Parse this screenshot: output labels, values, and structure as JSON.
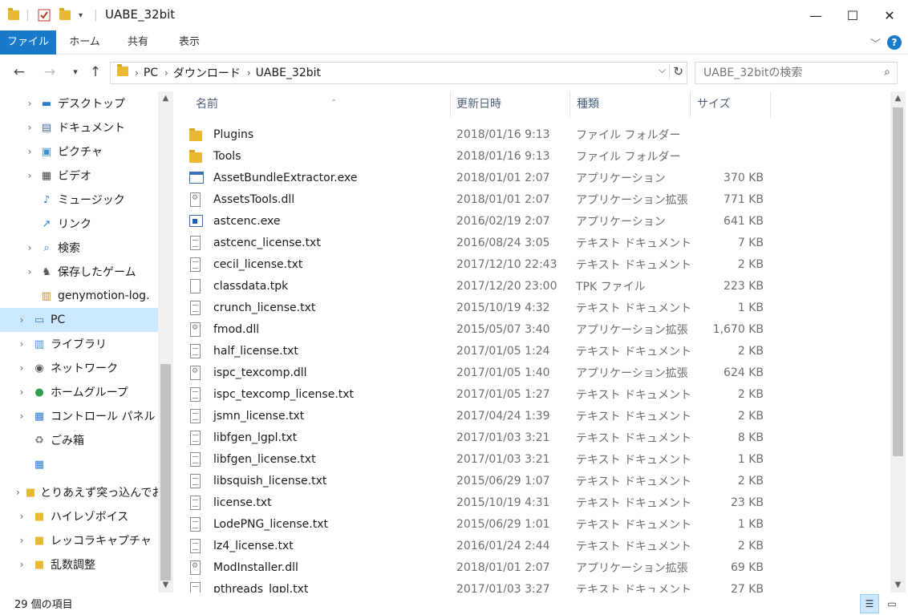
{
  "window": {
    "title": "UABE_32bit",
    "minimize": "—",
    "maximize": "☐",
    "close": "✕"
  },
  "ribbon": {
    "tabs": [
      "ファイル",
      "ホーム",
      "共有",
      "表示"
    ],
    "help": "?"
  },
  "address": {
    "crumbs": [
      "PC",
      "ダウンロード",
      "UABE_32bit"
    ]
  },
  "search": {
    "placeholder": "UABE_32bitの検索"
  },
  "nav_pane": {
    "items": [
      {
        "label": "デスクトップ",
        "icon": "desktop-icon",
        "expandable": true
      },
      {
        "label": "ドキュメント",
        "icon": "documents-icon",
        "expandable": true
      },
      {
        "label": "ピクチャ",
        "icon": "pictures-icon",
        "expandable": true
      },
      {
        "label": "ビデオ",
        "icon": "videos-icon",
        "expandable": true
      },
      {
        "label": "ミュージック",
        "icon": "music-icon",
        "expandable": false
      },
      {
        "label": "リンク",
        "icon": "links-icon",
        "expandable": false
      },
      {
        "label": "検索",
        "icon": "search-folder-icon",
        "expandable": true
      },
      {
        "label": "保存したゲーム",
        "icon": "saved-games-icon",
        "expandable": true
      },
      {
        "label": "genymotion-log.",
        "icon": "zip-icon",
        "expandable": false
      },
      {
        "label": "PC",
        "icon": "pc-icon",
        "expandable": true,
        "selected": true
      },
      {
        "label": "ライブラリ",
        "icon": "libraries-icon",
        "expandable": true
      },
      {
        "label": "ネットワーク",
        "icon": "network-icon",
        "expandable": true
      },
      {
        "label": "ホームグループ",
        "icon": "homegroup-icon",
        "expandable": true
      },
      {
        "label": "コントロール パネル",
        "icon": "control-panel-icon",
        "expandable": true
      },
      {
        "label": "ごみ箱",
        "icon": "recycle-bin-icon",
        "expandable": false
      },
      {
        "label": "",
        "icon": "control-panel-icon",
        "expandable": false
      },
      {
        "label": "とりあえず突っ込んでお",
        "icon": "folder-icon",
        "expandable": true
      },
      {
        "label": "ハイレゾボイス",
        "icon": "folder-icon",
        "expandable": true
      },
      {
        "label": "レッコラキャプチャ",
        "icon": "folder-icon",
        "expandable": true
      },
      {
        "label": "乱数調整",
        "icon": "folder-icon",
        "expandable": true
      }
    ]
  },
  "columns": {
    "name": "名前",
    "date": "更新日時",
    "type": "種類",
    "size": "サイズ"
  },
  "files": [
    {
      "name": "Plugins",
      "date": "2018/01/16 9:13",
      "type": "ファイル フォルダー",
      "size": "",
      "icon": "folder"
    },
    {
      "name": "Tools",
      "date": "2018/01/16 9:13",
      "type": "ファイル フォルダー",
      "size": "",
      "icon": "folder"
    },
    {
      "name": "AssetBundleExtractor.exe",
      "date": "2018/01/01 2:07",
      "type": "アプリケーション",
      "size": "370 KB",
      "icon": "exe"
    },
    {
      "name": "AssetsTools.dll",
      "date": "2018/01/01 2:07",
      "type": "アプリケーション拡張",
      "size": "771 KB",
      "icon": "dll"
    },
    {
      "name": "astcenc.exe",
      "date": "2016/02/19 2:07",
      "type": "アプリケーション",
      "size": "641 KB",
      "icon": "exe2"
    },
    {
      "name": "astcenc_license.txt",
      "date": "2016/08/24 3:05",
      "type": "テキスト ドキュメント",
      "size": "7 KB",
      "icon": "doc"
    },
    {
      "name": "cecil_license.txt",
      "date": "2017/12/10 22:43",
      "type": "テキスト ドキュメント",
      "size": "2 KB",
      "icon": "doc"
    },
    {
      "name": "classdata.tpk",
      "date": "2017/12/20 23:00",
      "type": "TPK ファイル",
      "size": "223 KB",
      "icon": "blank"
    },
    {
      "name": "crunch_license.txt",
      "date": "2015/10/19 4:32",
      "type": "テキスト ドキュメント",
      "size": "1 KB",
      "icon": "doc"
    },
    {
      "name": "fmod.dll",
      "date": "2015/05/07 3:40",
      "type": "アプリケーション拡張",
      "size": "1,670 KB",
      "icon": "dll"
    },
    {
      "name": "half_license.txt",
      "date": "2017/01/05 1:24",
      "type": "テキスト ドキュメント",
      "size": "2 KB",
      "icon": "doc"
    },
    {
      "name": "ispc_texcomp.dll",
      "date": "2017/01/05 1:40",
      "type": "アプリケーション拡張",
      "size": "624 KB",
      "icon": "dll"
    },
    {
      "name": "ispc_texcomp_license.txt",
      "date": "2017/01/05 1:27",
      "type": "テキスト ドキュメント",
      "size": "2 KB",
      "icon": "doc"
    },
    {
      "name": "jsmn_license.txt",
      "date": "2017/04/24 1:39",
      "type": "テキスト ドキュメント",
      "size": "2 KB",
      "icon": "doc"
    },
    {
      "name": "libfgen_lgpl.txt",
      "date": "2017/01/03 3:21",
      "type": "テキスト ドキュメント",
      "size": "8 KB",
      "icon": "doc"
    },
    {
      "name": "libfgen_license.txt",
      "date": "2017/01/03 3:21",
      "type": "テキスト ドキュメント",
      "size": "1 KB",
      "icon": "doc"
    },
    {
      "name": "libsquish_license.txt",
      "date": "2015/06/29 1:07",
      "type": "テキスト ドキュメント",
      "size": "2 KB",
      "icon": "doc"
    },
    {
      "name": "license.txt",
      "date": "2015/10/19 4:31",
      "type": "テキスト ドキュメント",
      "size": "23 KB",
      "icon": "doc"
    },
    {
      "name": "LodePNG_license.txt",
      "date": "2015/06/29 1:01",
      "type": "テキスト ドキュメント",
      "size": "1 KB",
      "icon": "doc"
    },
    {
      "name": "lz4_license.txt",
      "date": "2016/01/24 2:44",
      "type": "テキスト ドキュメント",
      "size": "2 KB",
      "icon": "doc"
    },
    {
      "name": "ModInstaller.dll",
      "date": "2018/01/01 2:07",
      "type": "アプリケーション拡張",
      "size": "69 KB",
      "icon": "dll"
    },
    {
      "name": "pthreads_lgpl.txt",
      "date": "2017/01/03 3:27",
      "type": "テキスト ドキュメント",
      "size": "27 KB",
      "icon": "doc"
    }
  ],
  "status": {
    "item_count": "29 個の項目"
  }
}
